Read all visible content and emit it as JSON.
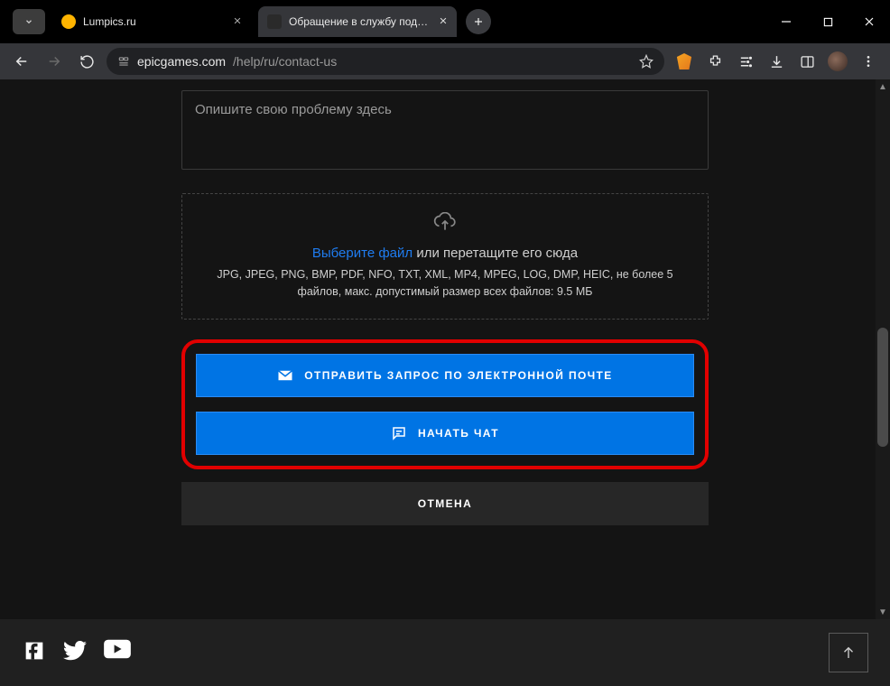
{
  "chrome": {
    "tabs": [
      {
        "title": "Lumpics.ru"
      },
      {
        "title": "Обращение в службу поддер"
      }
    ],
    "url_domain": "epicgames.com",
    "url_path": "/help/ru/contact-us"
  },
  "form": {
    "describe_placeholder": "Опишите свою проблему здесь",
    "upload": {
      "choose_file": "Выберите файл",
      "or_drop": " или перетащите его сюда",
      "formats": "JPG, JPEG, PNG, BMP, PDF, NFO, TXT, XML, MP4, MPEG, LOG, DMP, HEIC, не более 5 файлов, макс. допустимый размер всех файлов: 9.5 МБ"
    },
    "buttons": {
      "email": "ОТПРАВИТЬ ЗАПРОС ПО ЭЛЕКТРОННОЙ ПОЧТЕ",
      "chat": "НАЧАТЬ ЧАТ",
      "cancel": "ОТМЕНА"
    }
  }
}
